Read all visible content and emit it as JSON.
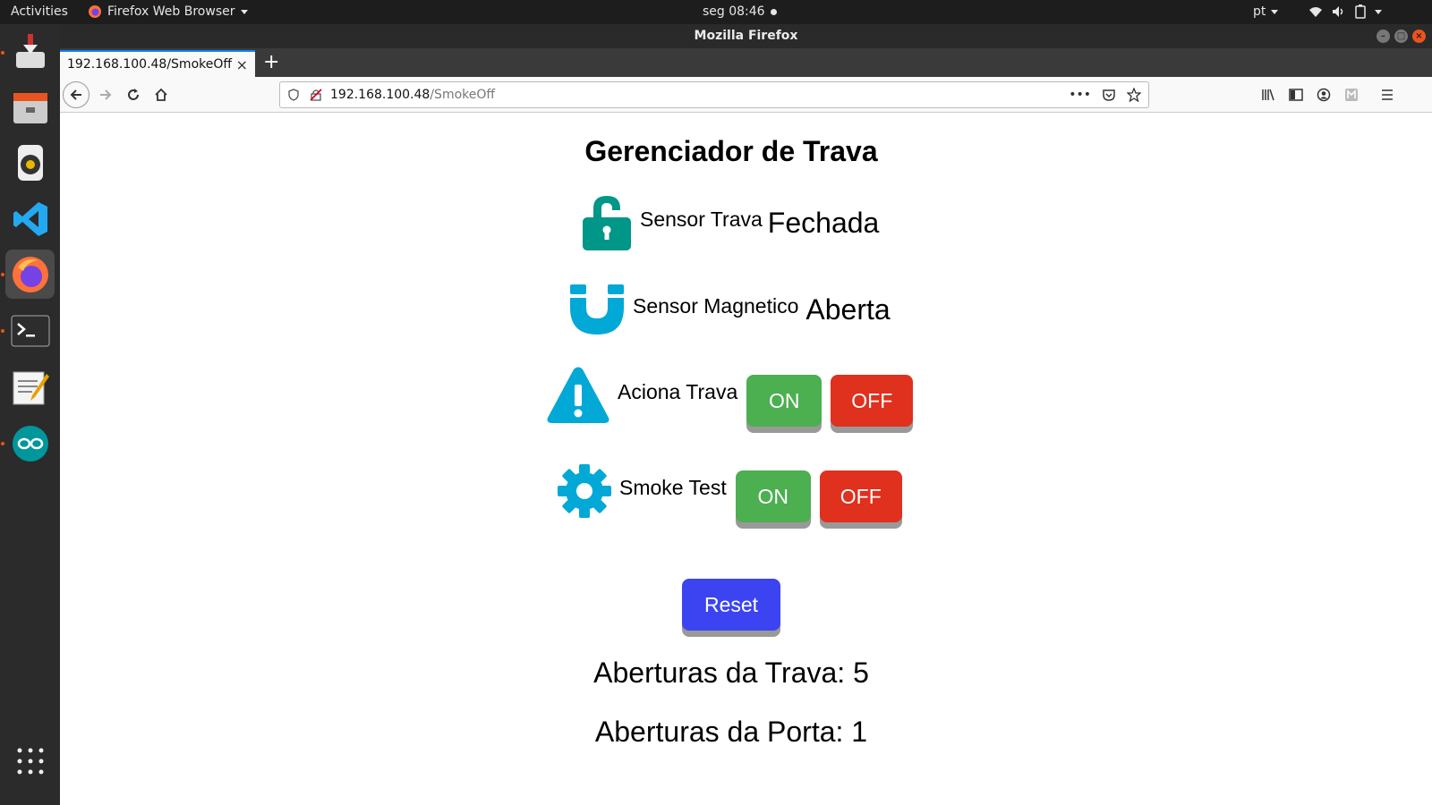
{
  "topbar": {
    "activities": "Activities",
    "app_name": "Firefox Web Browser",
    "clock": "seg 08:46",
    "language": "pt"
  },
  "window": {
    "title": "Mozilla Firefox"
  },
  "tab": {
    "title": "192.168.100.48/SmokeOff",
    "close": "×",
    "new": "+"
  },
  "navbar": {
    "url_host": "192.168.100.48",
    "url_path": "/SmokeOff",
    "more": "•••"
  },
  "page": {
    "title": "Gerenciador de Trava",
    "sensor_trava": {
      "label": "Sensor Trava",
      "state": "Fechada",
      "icon": "unlock-icon",
      "color": "#009688"
    },
    "sensor_magnetico": {
      "label": "Sensor Magnetico",
      "state": "Aberta",
      "icon": "magnet-icon",
      "color": "#03a9d6"
    },
    "aciona_trava": {
      "label": "Aciona Trava",
      "on": "ON",
      "off": "OFF",
      "icon": "warning-icon",
      "color": "#03a9d6"
    },
    "smoke_test": {
      "label": "Smoke Test",
      "on": "ON",
      "off": "OFF",
      "icon": "gear-icon",
      "color": "#03a9d6"
    },
    "reset": "Reset",
    "aberturas_trava": "Aberturas da Trava: 5",
    "aberturas_porta": "Aberturas da Porta: 1"
  }
}
